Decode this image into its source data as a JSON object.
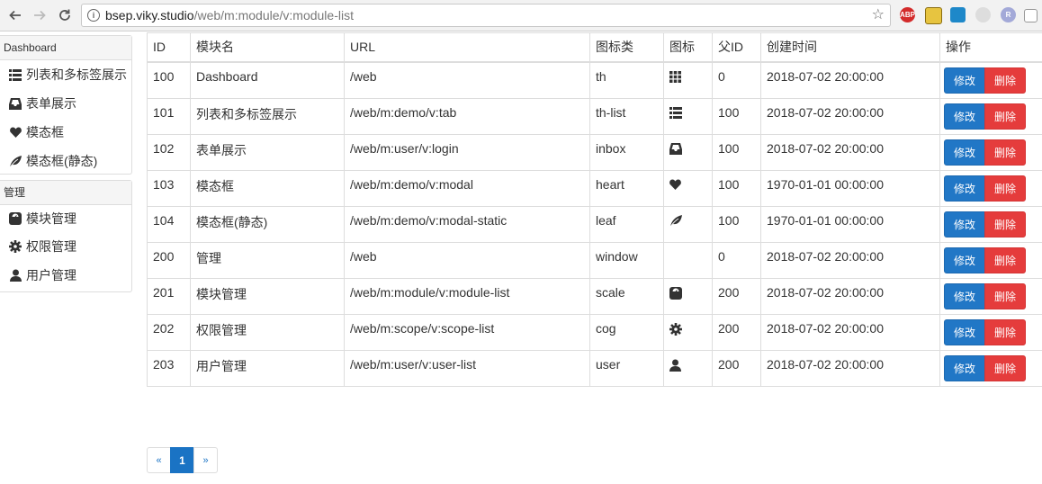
{
  "browser": {
    "url_host": "bsep.viky.studio",
    "url_path": "/web/m:module/v:module-list",
    "info_glyph": "i",
    "abp_label": "ABP",
    "ext_r_label": "R"
  },
  "sidebar": {
    "groups": [
      {
        "title": "Dashboard",
        "items": [
          {
            "label": "列表和多标签展示",
            "icon": "th-list-icon"
          },
          {
            "label": "表单展示",
            "icon": "inbox-icon"
          },
          {
            "label": "模态框",
            "icon": "heart-icon"
          },
          {
            "label": "模态框(静态)",
            "icon": "leaf-icon"
          }
        ]
      },
      {
        "title": "管理",
        "items": [
          {
            "label": "模块管理",
            "icon": "scale-icon"
          },
          {
            "label": "权限管理",
            "icon": "cog-icon"
          },
          {
            "label": "用户管理",
            "icon": "user-icon"
          }
        ]
      }
    ]
  },
  "table": {
    "headers": [
      "ID",
      "模块名",
      "URL",
      "图标类",
      "图标",
      "父ID",
      "创建时间",
      "操作"
    ],
    "rows": [
      {
        "id": "100",
        "name": "Dashboard",
        "url": "/web",
        "icon_class": "th",
        "icon": "th-icon",
        "parent": "0",
        "created": "2018-07-02 20:00:00"
      },
      {
        "id": "101",
        "name": "列表和多标签展示",
        "url": "/web/m:demo/v:tab",
        "icon_class": "th-list",
        "icon": "th-list-icon",
        "parent": "100",
        "created": "2018-07-02 20:00:00"
      },
      {
        "id": "102",
        "name": "表单展示",
        "url": "/web/m:user/v:login",
        "icon_class": "inbox",
        "icon": "inbox-icon",
        "parent": "100",
        "created": "2018-07-02 20:00:00"
      },
      {
        "id": "103",
        "name": "模态框",
        "url": "/web/m:demo/v:modal",
        "icon_class": "heart",
        "icon": "heart-icon",
        "parent": "100",
        "created": "1970-01-01 00:00:00"
      },
      {
        "id": "104",
        "name": "模态框(静态)",
        "url": "/web/m:demo/v:modal-static",
        "icon_class": "leaf",
        "icon": "leaf-icon",
        "parent": "100",
        "created": "1970-01-01 00:00:00"
      },
      {
        "id": "200",
        "name": "管理",
        "url": "/web",
        "icon_class": "window",
        "icon": "",
        "parent": "0",
        "created": "2018-07-02 20:00:00"
      },
      {
        "id": "201",
        "name": "模块管理",
        "url": "/web/m:module/v:module-list",
        "icon_class": "scale",
        "icon": "scale-icon",
        "parent": "200",
        "created": "2018-07-02 20:00:00"
      },
      {
        "id": "202",
        "name": "权限管理",
        "url": "/web/m:scope/v:scope-list",
        "icon_class": "cog",
        "icon": "cog-icon",
        "parent": "200",
        "created": "2018-07-02 20:00:00"
      },
      {
        "id": "203",
        "name": "用户管理",
        "url": "/web/m:user/v:user-list",
        "icon_class": "user",
        "icon": "user-icon",
        "parent": "200",
        "created": "2018-07-02 20:00:00"
      }
    ],
    "edit_label": "修改",
    "delete_label": "删除"
  },
  "pagination": {
    "prev": "«",
    "pages": [
      "1"
    ],
    "current": "1",
    "next": "»"
  },
  "colors": {
    "edit": "#2177c6",
    "delete": "#e53c3c",
    "page_active": "#1a73c4"
  }
}
